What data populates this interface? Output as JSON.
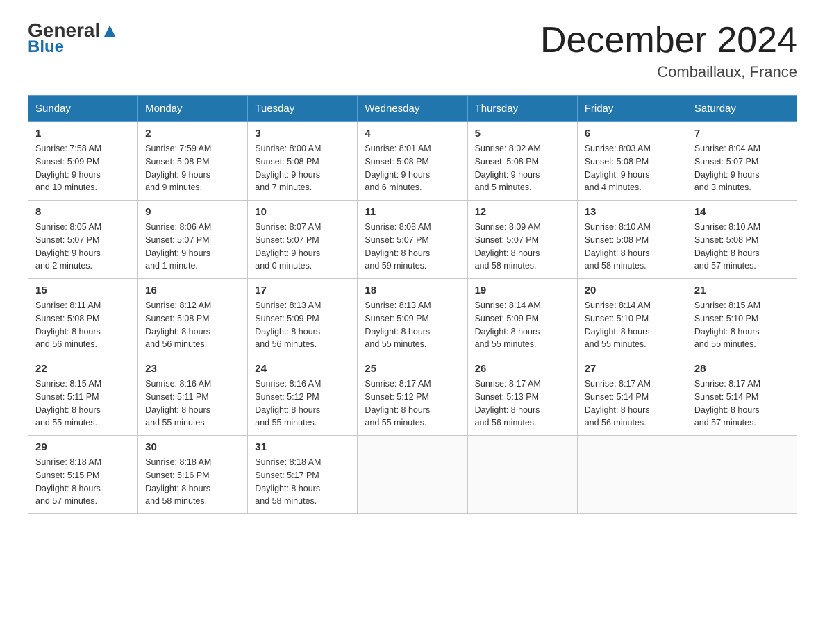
{
  "header": {
    "logo_general": "General",
    "logo_blue": "Blue",
    "title": "December 2024",
    "subtitle": "Combaillaux, France"
  },
  "days_of_week": [
    "Sunday",
    "Monday",
    "Tuesday",
    "Wednesday",
    "Thursday",
    "Friday",
    "Saturday"
  ],
  "weeks": [
    [
      {
        "num": "1",
        "info": "Sunrise: 7:58 AM\nSunset: 5:09 PM\nDaylight: 9 hours\nand 10 minutes."
      },
      {
        "num": "2",
        "info": "Sunrise: 7:59 AM\nSunset: 5:08 PM\nDaylight: 9 hours\nand 9 minutes."
      },
      {
        "num": "3",
        "info": "Sunrise: 8:00 AM\nSunset: 5:08 PM\nDaylight: 9 hours\nand 7 minutes."
      },
      {
        "num": "4",
        "info": "Sunrise: 8:01 AM\nSunset: 5:08 PM\nDaylight: 9 hours\nand 6 minutes."
      },
      {
        "num": "5",
        "info": "Sunrise: 8:02 AM\nSunset: 5:08 PM\nDaylight: 9 hours\nand 5 minutes."
      },
      {
        "num": "6",
        "info": "Sunrise: 8:03 AM\nSunset: 5:08 PM\nDaylight: 9 hours\nand 4 minutes."
      },
      {
        "num": "7",
        "info": "Sunrise: 8:04 AM\nSunset: 5:07 PM\nDaylight: 9 hours\nand 3 minutes."
      }
    ],
    [
      {
        "num": "8",
        "info": "Sunrise: 8:05 AM\nSunset: 5:07 PM\nDaylight: 9 hours\nand 2 minutes."
      },
      {
        "num": "9",
        "info": "Sunrise: 8:06 AM\nSunset: 5:07 PM\nDaylight: 9 hours\nand 1 minute."
      },
      {
        "num": "10",
        "info": "Sunrise: 8:07 AM\nSunset: 5:07 PM\nDaylight: 9 hours\nand 0 minutes."
      },
      {
        "num": "11",
        "info": "Sunrise: 8:08 AM\nSunset: 5:07 PM\nDaylight: 8 hours\nand 59 minutes."
      },
      {
        "num": "12",
        "info": "Sunrise: 8:09 AM\nSunset: 5:07 PM\nDaylight: 8 hours\nand 58 minutes."
      },
      {
        "num": "13",
        "info": "Sunrise: 8:10 AM\nSunset: 5:08 PM\nDaylight: 8 hours\nand 58 minutes."
      },
      {
        "num": "14",
        "info": "Sunrise: 8:10 AM\nSunset: 5:08 PM\nDaylight: 8 hours\nand 57 minutes."
      }
    ],
    [
      {
        "num": "15",
        "info": "Sunrise: 8:11 AM\nSunset: 5:08 PM\nDaylight: 8 hours\nand 56 minutes."
      },
      {
        "num": "16",
        "info": "Sunrise: 8:12 AM\nSunset: 5:08 PM\nDaylight: 8 hours\nand 56 minutes."
      },
      {
        "num": "17",
        "info": "Sunrise: 8:13 AM\nSunset: 5:09 PM\nDaylight: 8 hours\nand 56 minutes."
      },
      {
        "num": "18",
        "info": "Sunrise: 8:13 AM\nSunset: 5:09 PM\nDaylight: 8 hours\nand 55 minutes."
      },
      {
        "num": "19",
        "info": "Sunrise: 8:14 AM\nSunset: 5:09 PM\nDaylight: 8 hours\nand 55 minutes."
      },
      {
        "num": "20",
        "info": "Sunrise: 8:14 AM\nSunset: 5:10 PM\nDaylight: 8 hours\nand 55 minutes."
      },
      {
        "num": "21",
        "info": "Sunrise: 8:15 AM\nSunset: 5:10 PM\nDaylight: 8 hours\nand 55 minutes."
      }
    ],
    [
      {
        "num": "22",
        "info": "Sunrise: 8:15 AM\nSunset: 5:11 PM\nDaylight: 8 hours\nand 55 minutes."
      },
      {
        "num": "23",
        "info": "Sunrise: 8:16 AM\nSunset: 5:11 PM\nDaylight: 8 hours\nand 55 minutes."
      },
      {
        "num": "24",
        "info": "Sunrise: 8:16 AM\nSunset: 5:12 PM\nDaylight: 8 hours\nand 55 minutes."
      },
      {
        "num": "25",
        "info": "Sunrise: 8:17 AM\nSunset: 5:12 PM\nDaylight: 8 hours\nand 55 minutes."
      },
      {
        "num": "26",
        "info": "Sunrise: 8:17 AM\nSunset: 5:13 PM\nDaylight: 8 hours\nand 56 minutes."
      },
      {
        "num": "27",
        "info": "Sunrise: 8:17 AM\nSunset: 5:14 PM\nDaylight: 8 hours\nand 56 minutes."
      },
      {
        "num": "28",
        "info": "Sunrise: 8:17 AM\nSunset: 5:14 PM\nDaylight: 8 hours\nand 57 minutes."
      }
    ],
    [
      {
        "num": "29",
        "info": "Sunrise: 8:18 AM\nSunset: 5:15 PM\nDaylight: 8 hours\nand 57 minutes."
      },
      {
        "num": "30",
        "info": "Sunrise: 8:18 AM\nSunset: 5:16 PM\nDaylight: 8 hours\nand 58 minutes."
      },
      {
        "num": "31",
        "info": "Sunrise: 8:18 AM\nSunset: 5:17 PM\nDaylight: 8 hours\nand 58 minutes."
      },
      null,
      null,
      null,
      null
    ]
  ]
}
